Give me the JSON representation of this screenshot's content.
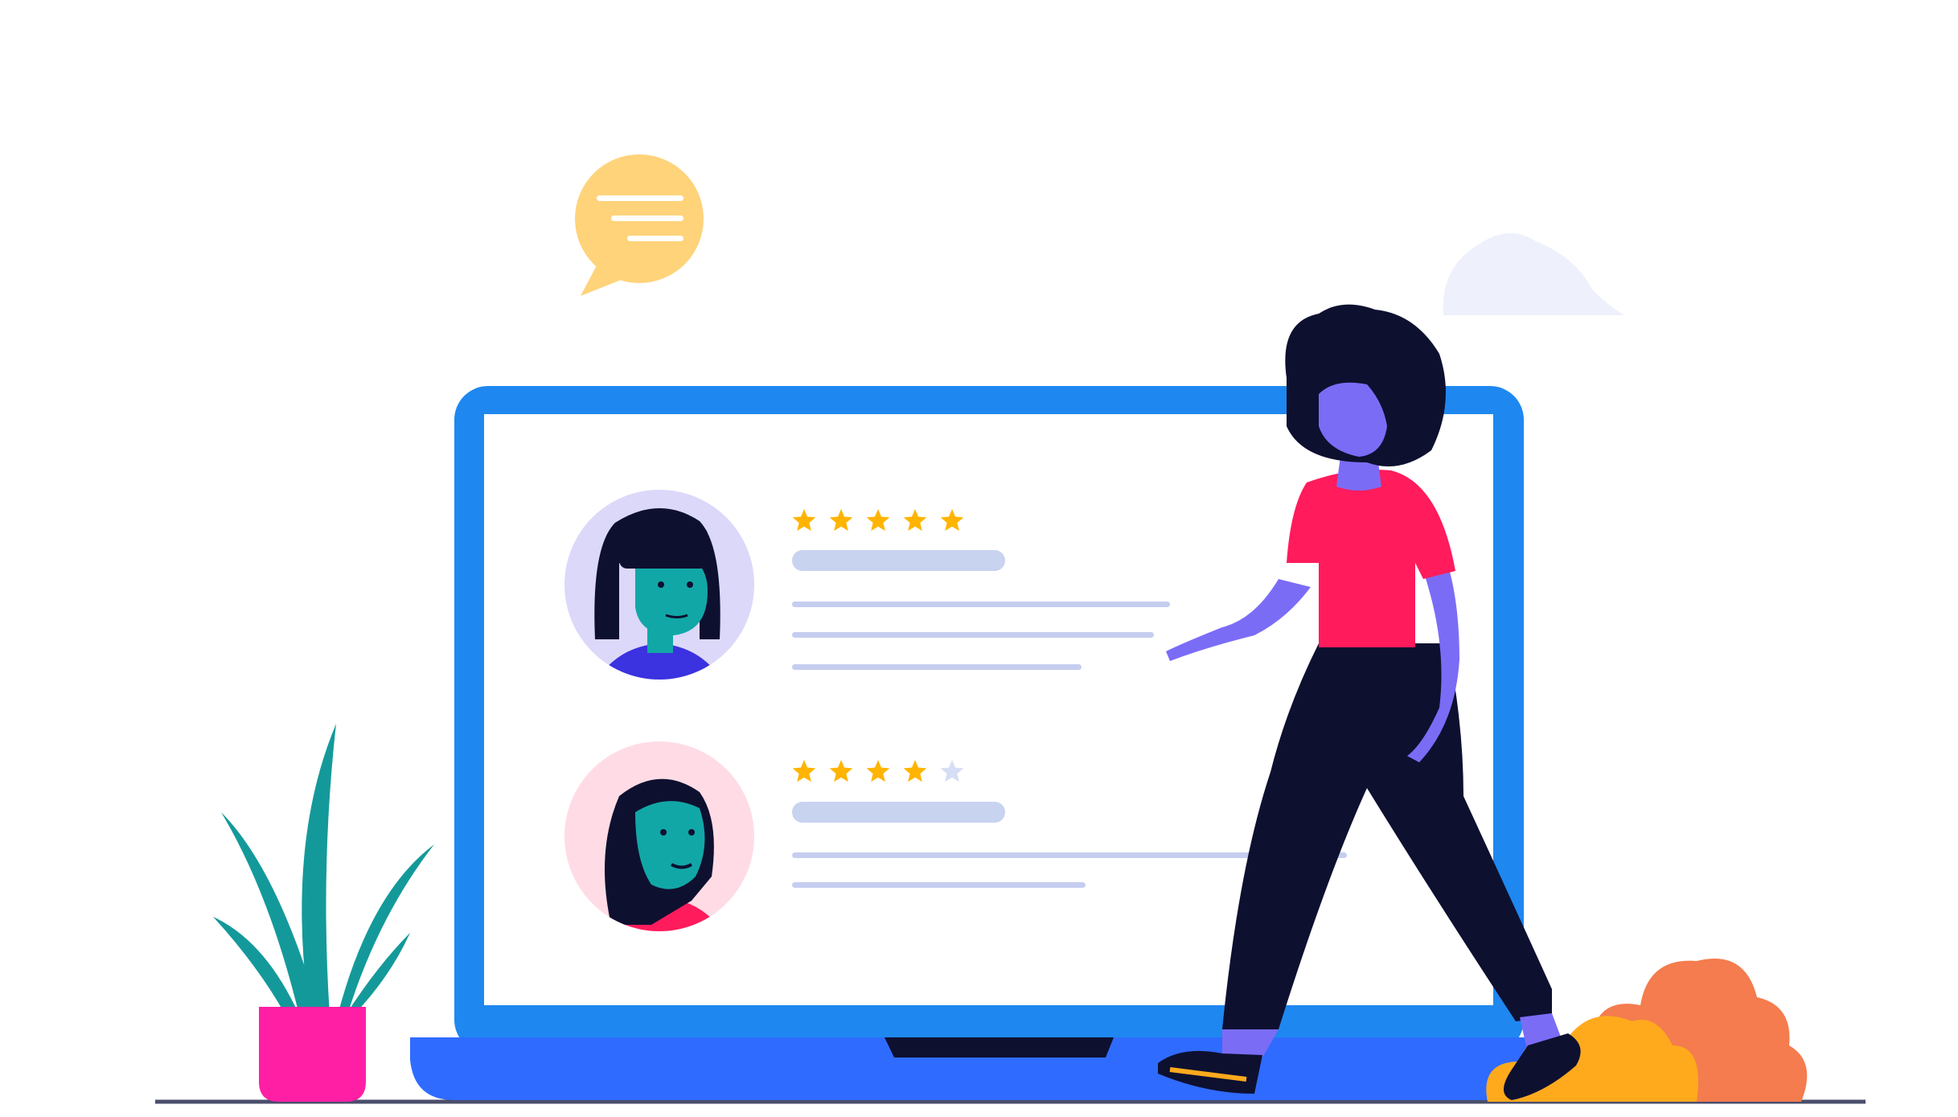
{
  "illustration": {
    "subject": "customer-reviews-on-laptop",
    "colors": {
      "laptop_frame": "#1E88F0",
      "laptop_base": "#2F6BFF",
      "screen": "#FFFFFF",
      "skeleton_bar": "#C8D3F0",
      "skeleton_line": "#C5CEEF",
      "star_filled": "#FFB400",
      "star_empty": "#D6DEF5",
      "chat_bubble": "#FFD37A",
      "cloud": "#EEF1FB",
      "plant_pot": "#FF1FA5",
      "plant_leaves": "#14999A",
      "bush_back": "#F47C4E",
      "bush_front": "#FFAA1D",
      "person_skin": "#7B6CF6",
      "person_shirt": "#FF1B5C",
      "person_pants": "#0E1030",
      "reviewer_skin": "#12A7A7",
      "ground_line": "#4B4E6B"
    },
    "reviews": [
      {
        "avatar_icon": "reviewer-avatar-female-short-hair",
        "avatar_bg": "#DCD8FA",
        "shirt_color": "#3B32E0",
        "rating": 5,
        "max_rating": 5
      },
      {
        "avatar_icon": "reviewer-avatar-female-long-hair",
        "avatar_bg": "#FFDCE5",
        "shirt_color": "#FF1B5C",
        "rating": 4,
        "max_rating": 5
      }
    ],
    "decorations": [
      "chat-bubble-icon",
      "cloud-icon",
      "potted-plant",
      "bush",
      "walking-person"
    ]
  }
}
